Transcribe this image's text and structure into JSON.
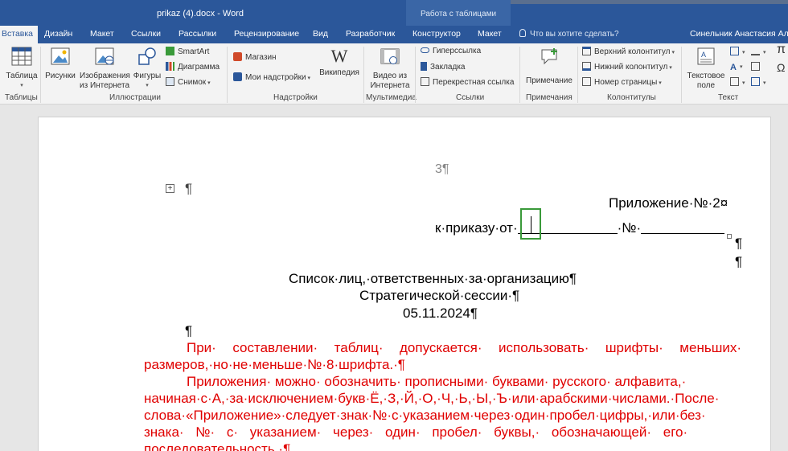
{
  "window": {
    "title": "prikaz (4).docx - Word",
    "context_group": "Работа с таблицами",
    "user": "Синельник Анастасия Але"
  },
  "tabs": {
    "insert": "Вставка",
    "design": "Дизайн",
    "layout": "Макет",
    "references": "Ссылки",
    "mailings": "Рассылки",
    "review": "Рецензирование",
    "view": "Вид",
    "developer": "Разработчик",
    "table_design": "Конструктор",
    "table_layout": "Макет",
    "tell_me": "Что вы хотите сделать?"
  },
  "ribbon": {
    "groups": {
      "tables": "Таблицы",
      "illustrations": "Иллюстрации",
      "addins": "Надстройки",
      "media": "Мультимедиа",
      "links": "Ссылки",
      "comments": "Примечания",
      "header_footer": "Колонтитулы",
      "text": "Текст"
    },
    "buttons": {
      "table": "Таблица",
      "pictures": "Рисунки",
      "online_pictures_1": "Изображения",
      "online_pictures_2": "из Интернета",
      "shapes": "Фигуры",
      "smartart": "SmartArt",
      "chart": "Диаграмма",
      "screenshot": "Снимок",
      "store": "Магазин",
      "my_addins": "Мои надстройки",
      "wikipedia": "Википедия",
      "online_video_1": "Видео из",
      "online_video_2": "Интернета",
      "hyperlink": "Гиперссылка",
      "bookmark": "Закладка",
      "cross_reference": "Перекрестная ссылка",
      "comment": "Примечание",
      "header": "Верхний колонтитул",
      "footer": "Нижний колонтитул",
      "page_number": "Номер страницы",
      "textbox_1": "Текстовое",
      "textbox_2": "поле"
    }
  },
  "document": {
    "page_number": "3¶",
    "empty_mark": "¶",
    "appendix_title": "Приложение·№·2¤",
    "order_ref_prefix": "к·приказу·от·",
    "order_ref_no": "·№·",
    "para_mark": "¶",
    "heading_1": "Список·лиц,·ответственных·за·организацию¶",
    "heading_2": "Стратегической·сессии·¶",
    "heading_3": "05.11.2024¶",
    "note1_line1": "При· составлении· таблиц· допускается· использовать· шрифты· меньших·",
    "note1_line2": "размеров,·но·не·меньше·№·8·шрифта.·¶",
    "note2_line1": "Приложения· можно· обозначить· прописными· буквами· русского· алфавита,·",
    "note2_line2": "начиная·с·А,·за·исключением·букв·Ё,·З,·Й,·О,·Ч,·Ь,·Ы,·Ъ·или·арабскими·числами.·После·",
    "note2_line3": "слова·«Приложение»·следует·знак·№·с·указанием·через·один·пробел·цифры,·или·без·",
    "note2_line4": "знака· №· с· указанием· через· один· пробел· буквы,· обозначающей· его·",
    "note2_line5": "последовательность.·¶"
  },
  "colors": {
    "word_blue": "#2b579a",
    "red_text": "#e00000",
    "cursor_box": "#3a9a3a"
  }
}
